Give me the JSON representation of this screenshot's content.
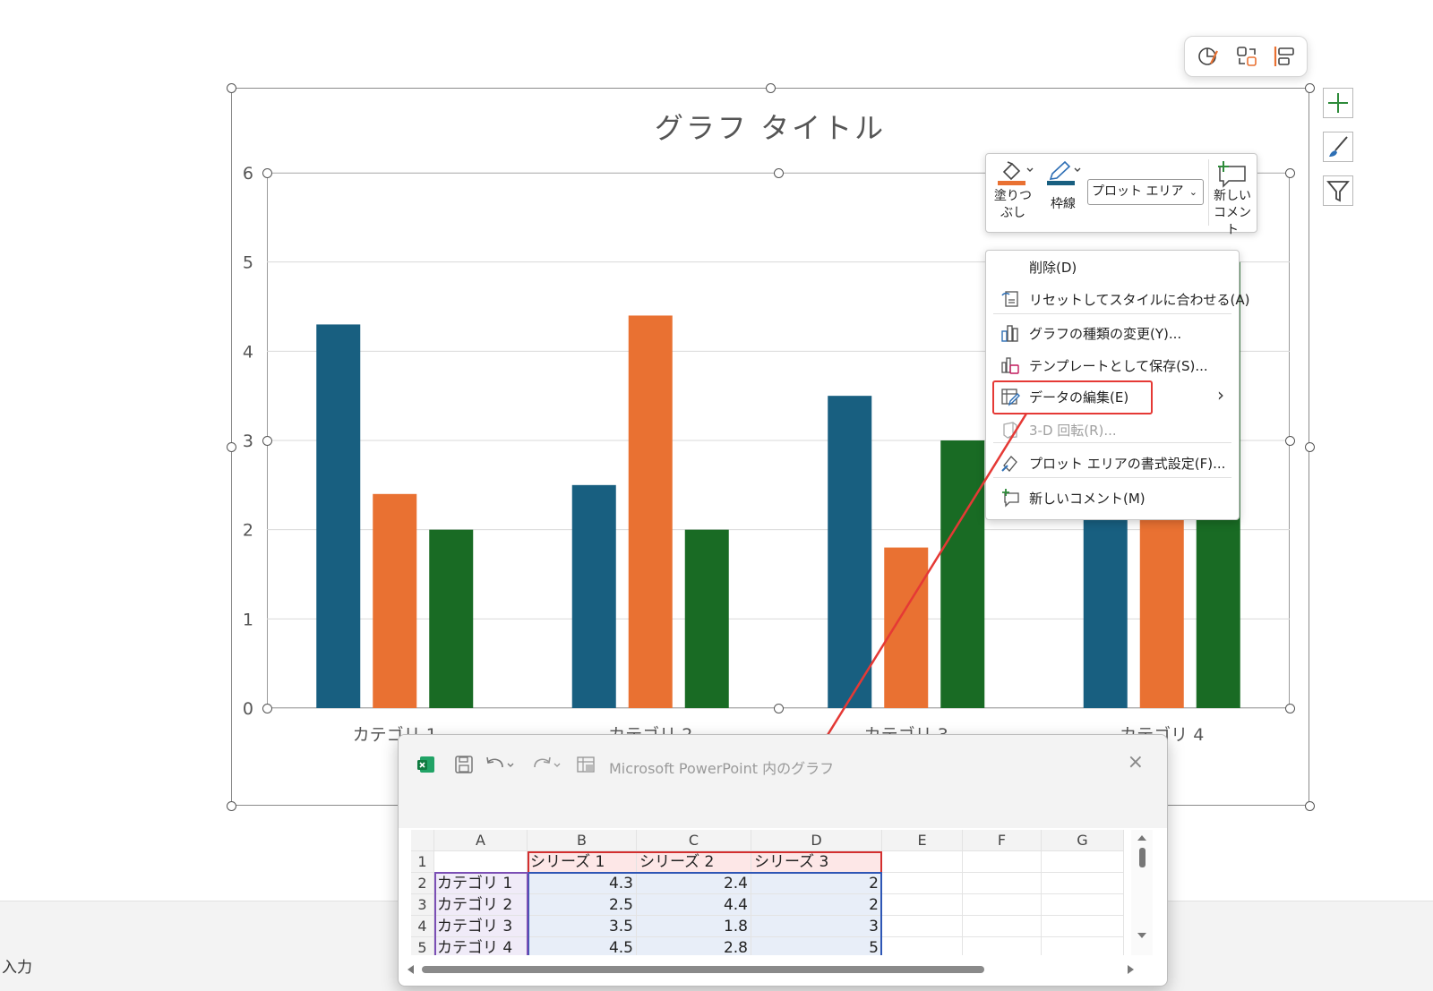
{
  "chart": {
    "title": "グラフ タイトル"
  },
  "chart_data": {
    "type": "bar",
    "title": "グラフ タイトル",
    "categories": [
      "カテゴリ 1",
      "カテゴリ 2",
      "カテゴリ 3",
      "カテゴリ 4"
    ],
    "series": [
      {
        "name": "シリーズ 1",
        "values": [
          4.3,
          2.5,
          3.5,
          4.5
        ],
        "color": "#185f80"
      },
      {
        "name": "シリーズ 2",
        "values": [
          2.4,
          4.4,
          1.8,
          2.8
        ],
        "color": "#e97132"
      },
      {
        "name": "シリーズ 3",
        "values": [
          2,
          2,
          3,
          5
        ],
        "color": "#196b24"
      }
    ],
    "ylim": [
      0,
      6
    ],
    "yticks": [
      "0",
      "1",
      "2",
      "3",
      "4",
      "5",
      "6"
    ],
    "grid": true
  },
  "quick_bar": {
    "icons": [
      "chart-style-icon",
      "switch-row-column-icon",
      "layout-icon"
    ]
  },
  "side_buttons": {
    "icons": [
      "chart-elements-plus-icon",
      "chart-styles-brush-icon",
      "chart-filter-icon"
    ]
  },
  "mini_toolbar": {
    "fill_label_1": "塗りつ",
    "fill_label_2": "ぶし",
    "outline_label": "枠線",
    "area_select": "プロット エリア",
    "comment_label_1": "新しい",
    "comment_label_2": "コメント",
    "fill_color": "#e97132",
    "outline_color": "#185f80"
  },
  "context_menu": {
    "items": [
      {
        "label": "削除(D)",
        "icon": "",
        "enabled": true
      },
      {
        "label": "リセットしてスタイルに合わせる(A)",
        "icon": "reset-style-icon",
        "enabled": true
      },
      {
        "label": "グラフの種類の変更(Y)...",
        "icon": "chart-type-icon",
        "enabled": true
      },
      {
        "label": "テンプレートとして保存(S)...",
        "icon": "save-template-icon",
        "enabled": true
      },
      {
        "label": "データの編集(E)",
        "icon": "edit-data-icon",
        "enabled": true,
        "has_submenu": true
      },
      {
        "label": "3-D 回転(R)...",
        "icon": "rotate-3d-icon",
        "enabled": false
      },
      {
        "label": "プロット エリアの書式設定(F)...",
        "icon": "format-area-icon",
        "enabled": true
      },
      {
        "label": "新しいコメント(M)",
        "icon": "new-comment-icon",
        "enabled": true
      }
    ],
    "submenu_arrow": "›"
  },
  "excel_window": {
    "title": "Microsoft PowerPoint 内のグラフ",
    "close": "×",
    "columns": [
      "A",
      "B",
      "C",
      "D",
      "E",
      "F",
      "G"
    ],
    "rows": [
      {
        "num": "1",
        "cells": [
          "",
          "シリーズ 1",
          "シリーズ 2",
          "シリーズ 3",
          "",
          "",
          ""
        ]
      },
      {
        "num": "2",
        "cells": [
          "カテゴリ 1",
          "4.3",
          "2.4",
          "2",
          "",
          "",
          ""
        ]
      },
      {
        "num": "3",
        "cells": [
          "カテゴリ 2",
          "2.5",
          "4.4",
          "2",
          "",
          "",
          ""
        ]
      },
      {
        "num": "4",
        "cells": [
          "カテゴリ 3",
          "3.5",
          "1.8",
          "3",
          "",
          "",
          ""
        ]
      },
      {
        "num": "5",
        "cells": [
          "カテゴリ 4",
          "4.5",
          "2.8",
          "5",
          "",
          "",
          ""
        ]
      }
    ]
  },
  "status": {
    "notes_hint": "入力"
  }
}
